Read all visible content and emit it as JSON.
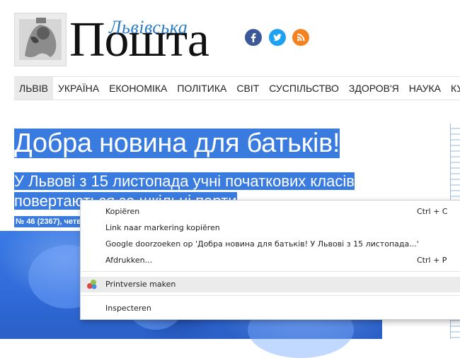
{
  "header": {
    "logo_subtitle": "Львівська",
    "logo_title": "Пошта",
    "social": [
      {
        "name": "facebook-icon",
        "glyph": "f",
        "color": "#3b5998"
      },
      {
        "name": "twitter-icon",
        "glyph": "t",
        "color": "#1da1f2"
      },
      {
        "name": "rss-icon",
        "glyph": "rss",
        "color": "#f58220"
      }
    ]
  },
  "nav": {
    "items": [
      "ЛЬВІВ",
      "УКРАЇНА",
      "ЕКОНОМІКА",
      "ПОЛІТИКА",
      "СВІТ",
      "СУСПІЛЬСТВО",
      "ЗДОРОВ'Я",
      "НАУКА",
      "КУЛЬ"
    ]
  },
  "article": {
    "title": "Добра новина для батьків!",
    "subtitle": "У Львові з 15 листопада учні початкових класів повертаються за шкільні парти",
    "meta": "№ 46 (2367), четв"
  },
  "context_menu": {
    "items": {
      "copy": {
        "label": "Kopiëren",
        "shortcut": "Ctrl + C"
      },
      "copy_link": {
        "label": "Link naar markering kopiëren"
      },
      "search": {
        "label": "Google doorzoeken op 'Добра новина для батьків! У Львові з 15 листопада...'"
      },
      "print": {
        "label": "Afdrukken...",
        "shortcut": "Ctrl + P"
      },
      "print_version": {
        "label": "Printversie maken"
      },
      "inspect": {
        "label": "Inspecteren"
      }
    }
  },
  "colors": {
    "selection": "#3a7be0",
    "accent": "#2a7cc4"
  }
}
